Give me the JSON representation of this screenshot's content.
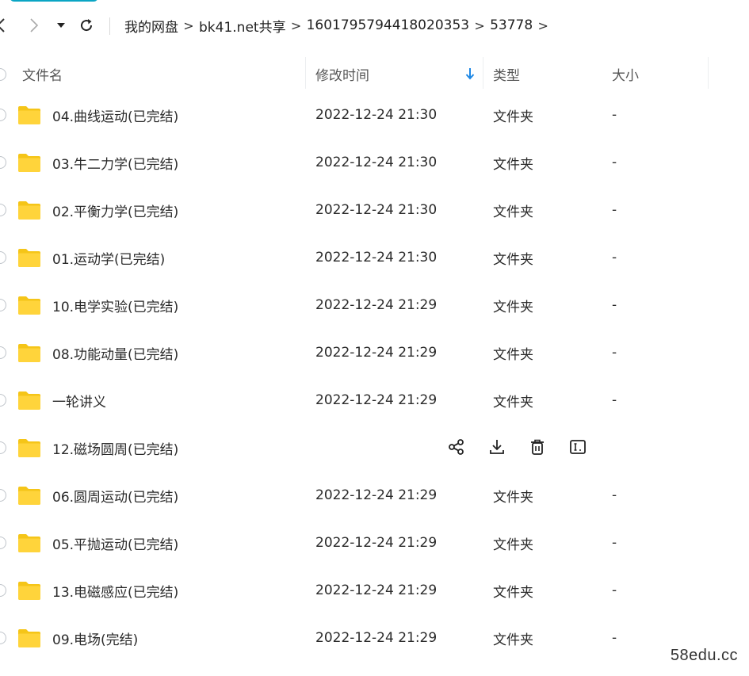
{
  "toolbar": {
    "back_icon": "chevron-left-icon",
    "forward_icon": "chevron-right-icon",
    "dropdown_icon": "caret-down-icon",
    "refresh_icon": "refresh-icon",
    "breadcrumb": [
      "我的网盘",
      "bk41.net共享",
      "1601795794418020353",
      "53778"
    ]
  },
  "columns": {
    "name": "文件名",
    "modified": "修改时间",
    "type": "类型",
    "size": "大小",
    "sort_icon": "arrow-down-icon"
  },
  "rows": [
    {
      "name": "04.曲线运动(已完结)",
      "modified": "2022-12-24 21:30",
      "type": "文件夹",
      "size": "-"
    },
    {
      "name": "03.牛二力学(已完结)",
      "modified": "2022-12-24 21:30",
      "type": "文件夹",
      "size": "-"
    },
    {
      "name": "02.平衡力学(已完结)",
      "modified": "2022-12-24 21:30",
      "type": "文件夹",
      "size": "-"
    },
    {
      "name": "01.运动学(已完结)",
      "modified": "2022-12-24 21:30",
      "type": "文件夹",
      "size": "-"
    },
    {
      "name": "10.电学实验(已完结)",
      "modified": "2022-12-24 21:29",
      "type": "文件夹",
      "size": "-"
    },
    {
      "name": "08.功能动量(已完结)",
      "modified": "2022-12-24 21:29",
      "type": "文件夹",
      "size": "-"
    },
    {
      "name": "一轮讲义",
      "modified": "2022-12-24 21:29",
      "type": "文件夹",
      "size": "-"
    },
    {
      "name": "12.磁场圆周(已完结)",
      "modified": "",
      "type": "",
      "size": "",
      "hovered": true
    },
    {
      "name": "06.圆周运动(已完结)",
      "modified": "2022-12-24 21:29",
      "type": "文件夹",
      "size": "-"
    },
    {
      "name": "05.平抛运动(已完结)",
      "modified": "2022-12-24 21:29",
      "type": "文件夹",
      "size": "-"
    },
    {
      "name": "13.电磁感应(已完结)",
      "modified": "2022-12-24 21:29",
      "type": "文件夹",
      "size": "-"
    },
    {
      "name": "09.电场(完结)",
      "modified": "2022-12-24 21:29",
      "type": "文件夹",
      "size": "-"
    }
  ],
  "row_actions": [
    "share-icon",
    "download-icon",
    "delete-icon",
    "rename-icon"
  ],
  "colors": {
    "folder": "#FFD43B",
    "folder_back": "#F5C518",
    "accent": "#0aa5c4",
    "sort_arrow": "#1e88e5"
  },
  "watermark": "58edu.cc"
}
